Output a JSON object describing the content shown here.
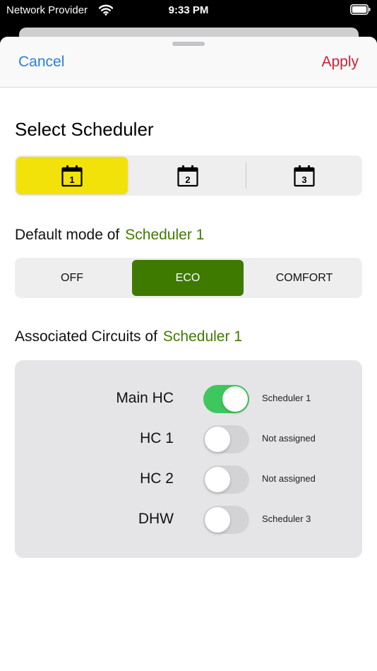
{
  "status_bar": {
    "carrier": "Network Provider",
    "time": "9:33 PM"
  },
  "header": {
    "cancel_label": "Cancel",
    "apply_label": "Apply"
  },
  "select_scheduler": {
    "title": "Select Scheduler",
    "options": [
      "1",
      "2",
      "3"
    ],
    "selected_index": 0
  },
  "default_mode": {
    "label": "Default mode of",
    "scheduler_name": "Scheduler 1",
    "options": [
      "OFF",
      "ECO",
      "COMFORT"
    ],
    "selected_index": 1
  },
  "associated_circuits": {
    "label": "Associated Circuits of",
    "scheduler_name": "Scheduler 1",
    "circuits": [
      {
        "name": "Main HC",
        "enabled": true,
        "status": "Scheduler 1"
      },
      {
        "name": "HC 1",
        "enabled": false,
        "status": "Not assigned"
      },
      {
        "name": "HC 2",
        "enabled": false,
        "status": "Not assigned"
      },
      {
        "name": "DHW",
        "enabled": false,
        "status": "Scheduler 3"
      }
    ]
  },
  "colors": {
    "accent_blue": "#2a7fe0",
    "apply_red": "#cd1f33",
    "scheduler_yellow": "#f3e20a",
    "mode_green": "#3f7a00",
    "toggle_on_green": "#3ec75e"
  },
  "icons": {
    "wifi": "wifi-icon",
    "battery": "battery-icon",
    "scheduler_option": "calendar-icon"
  }
}
